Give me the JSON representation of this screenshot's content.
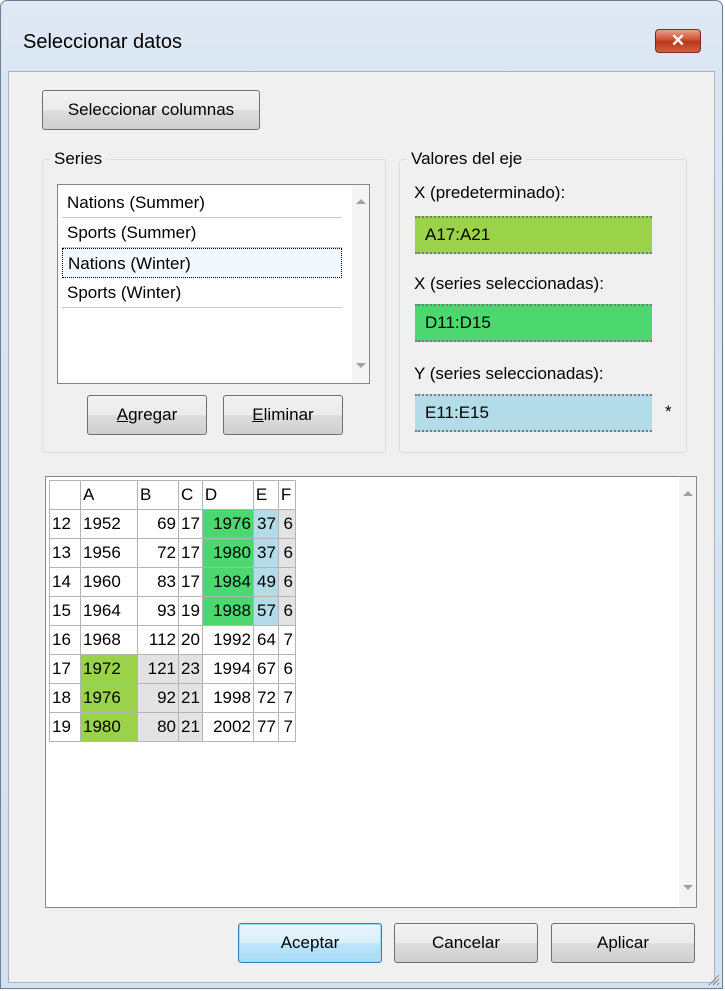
{
  "window": {
    "title": "Seleccionar datos",
    "close_glyph": "✕"
  },
  "buttons": {
    "select_columns": "Seleccionar columnas",
    "add": {
      "mnemonic": "A",
      "rest": "gregar"
    },
    "remove": {
      "mnemonic": "E",
      "rest": "liminar"
    },
    "ok": "Aceptar",
    "cancel": "Cancelar",
    "apply": "Aplicar"
  },
  "series": {
    "label": "Series",
    "items": [
      "Nations (Summer)",
      "Sports (Summer)",
      "Nations (Winter)",
      "Sports (Winter)"
    ],
    "selected_index": 2
  },
  "axis_values": {
    "label": "Valores del eje",
    "x_default": {
      "label": "X (predeterminado):",
      "value": "A17:A21",
      "color": "#9ad34a"
    },
    "x_selected": {
      "label": "X (series seleccionadas):",
      "value": "D11:D15",
      "color": "#4cd86f"
    },
    "y_selected": {
      "label": "Y (series seleccionadas):",
      "value": "E11:E15",
      "color": "#b4dbe8",
      "marker": "*"
    }
  },
  "grid": {
    "columns": [
      "A",
      "B",
      "C",
      "D",
      "E",
      "F"
    ],
    "rows": [
      {
        "n": "12",
        "cells": [
          "1952",
          "69",
          "17",
          "1976",
          "37",
          "6"
        ]
      },
      {
        "n": "13",
        "cells": [
          "1956",
          "72",
          "17",
          "1980",
          "37",
          "6"
        ]
      },
      {
        "n": "14",
        "cells": [
          "1960",
          "83",
          "17",
          "1984",
          "49",
          "6"
        ]
      },
      {
        "n": "15",
        "cells": [
          "1964",
          "93",
          "19",
          "1988",
          "57",
          "6"
        ]
      },
      {
        "n": "16",
        "cells": [
          "1968",
          "112",
          "20",
          "1992",
          "64",
          "7"
        ]
      },
      {
        "n": "17",
        "cells": [
          "1972",
          "121",
          "23",
          "1994",
          "67",
          "6"
        ]
      },
      {
        "n": "18",
        "cells": [
          "1976",
          "92",
          "21",
          "1998",
          "72",
          "7"
        ]
      },
      {
        "n": "19",
        "cells": [
          "1980",
          "80",
          "21",
          "2002",
          "77",
          "7"
        ]
      }
    ]
  },
  "icons": {
    "close": "close-icon",
    "scroll_up": "scroll-up-arrow-icon",
    "scroll_down": "scroll-down-arrow-icon",
    "resize_grip": "resize-grip-icon"
  }
}
